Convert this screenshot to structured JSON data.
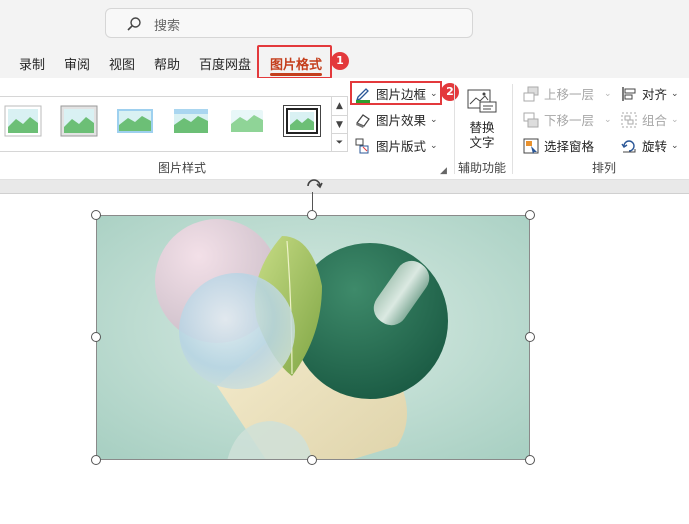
{
  "search": {
    "placeholder": "搜索"
  },
  "tabs": [
    {
      "label": "录制"
    },
    {
      "label": "审阅"
    },
    {
      "label": "视图"
    },
    {
      "label": "帮助"
    },
    {
      "label": "百度网盘"
    },
    {
      "label": "图片格式",
      "active": true
    }
  ],
  "badges": {
    "step1": "1",
    "step2": "2"
  },
  "ribbon": {
    "picture_styles": {
      "group_label": "图片样式"
    },
    "border_button": {
      "label": "图片边框"
    },
    "effects_button": {
      "label": "图片效果"
    },
    "layout_button": {
      "label": "图片版式"
    },
    "accessibility": {
      "alt_text_line1": "替换",
      "alt_text_line2": "文字",
      "group_label": "辅助功能"
    },
    "arrange": {
      "bring_forward": "上移一层",
      "send_backward": "下移一层",
      "selection_pane": "选择窗格",
      "align": "对齐",
      "group": "组合",
      "rotate": "旋转",
      "group_label": "排列"
    }
  },
  "colors": {
    "accent": "#c43e1c",
    "highlight": "#e3393c"
  }
}
